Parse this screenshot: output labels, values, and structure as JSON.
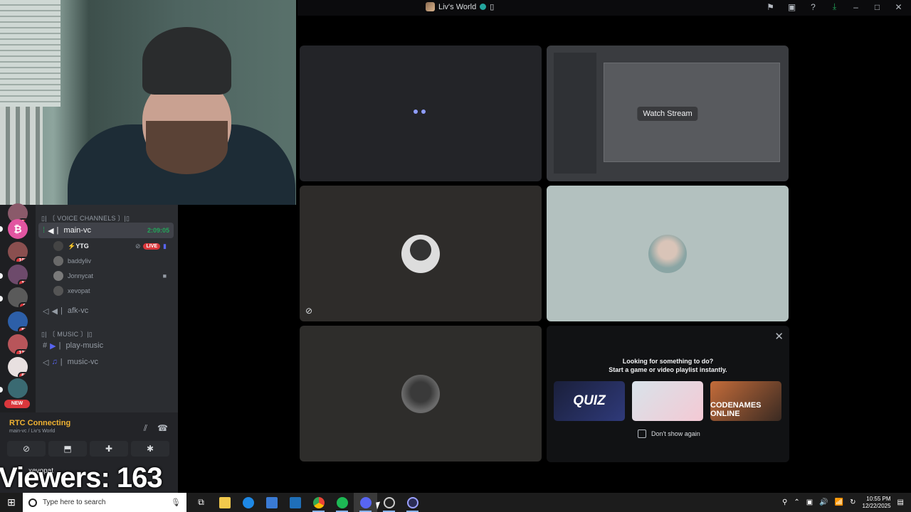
{
  "window": {
    "title": "Liv's World",
    "title_glyph": "▯"
  },
  "webcam": {
    "label": "streamer-webcam"
  },
  "servers": {
    "badges": [
      "14",
      "105",
      "16",
      "8",
      "55",
      "122",
      "66"
    ],
    "new_label": "NEW"
  },
  "channels": {
    "voice_category": "▯| 〔 VOICE CHANNELS 〕|▯",
    "main_vc": {
      "name": "main-vc",
      "timer": "2:09:05"
    },
    "members": [
      {
        "name": "⚡YTG",
        "live_label": "LIVE"
      },
      {
        "name": "baddyliv"
      },
      {
        "name": "Jonnycat"
      },
      {
        "name": "xevopat"
      }
    ],
    "afk_vc": "afk-vc",
    "music_category": "▯| 〔 MUSIC 〕|▯",
    "play_music": "play-music",
    "music_vc": "music-vc"
  },
  "voice_status": {
    "state": "RTC Connecting",
    "location": "main-vc / Liv's World",
    "user": "xevopat"
  },
  "overlay": {
    "viewers": "Viewers: 163"
  },
  "tiles": {
    "watch_stream": "Watch Stream"
  },
  "activity": {
    "title_line1": "Looking for something to do?",
    "title_line2": "Start a game or video playlist instantly.",
    "games": [
      "QUIZ",
      "",
      "CODENAMES ONLINE"
    ],
    "dont_show": "Don't show again"
  },
  "taskbar": {
    "search_placeholder": "Type here to search",
    "time": "10:55 PM",
    "date": "12/22/2025"
  },
  "colors": {
    "accent": "#5865f2",
    "online": "#23a55a",
    "live": "#da373c",
    "connecting": "#f0b232"
  }
}
